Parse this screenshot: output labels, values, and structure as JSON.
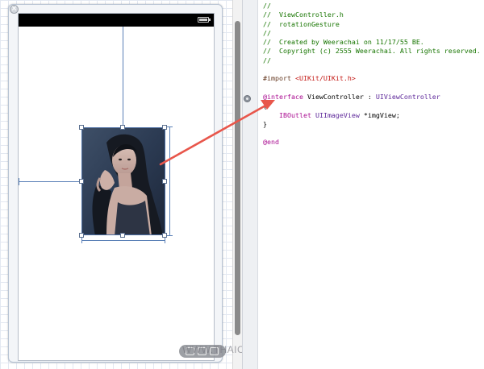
{
  "canvas": {
    "close_icon": "close-icon",
    "image_view": {
      "icon": "photo-of-woman"
    },
    "watermark": "WWW.THAICREATE.COM",
    "bottom_bar_icons": [
      "layout-icon",
      "size-icon",
      "resize-icon"
    ]
  },
  "colors": {
    "comment": "#177500",
    "keyword": "#aa0d91",
    "string": "#c41a16",
    "type": "#5c2699",
    "arrow": "#e8564b",
    "guide": "#5a80b7"
  },
  "editor": {
    "lines": [
      {
        "segments": [
          {
            "text": "//",
            "cls": "comment"
          }
        ]
      },
      {
        "segments": [
          {
            "text": "//  ViewController.h",
            "cls": "comment"
          }
        ]
      },
      {
        "segments": [
          {
            "text": "//  rotationGesture",
            "cls": "comment"
          }
        ]
      },
      {
        "segments": [
          {
            "text": "//",
            "cls": "comment"
          }
        ]
      },
      {
        "segments": [
          {
            "text": "//  Created by Weerachai on 11/17/55 BE.",
            "cls": "comment"
          }
        ]
      },
      {
        "segments": [
          {
            "text": "//  Copyright (c) 2555 Weerachai. All rights reserved.",
            "cls": "comment"
          }
        ]
      },
      {
        "segments": [
          {
            "text": "//",
            "cls": "comment"
          }
        ]
      },
      {
        "segments": [
          {
            "text": "",
            "cls": ""
          }
        ]
      },
      {
        "segments": [
          {
            "text": "#import ",
            "cls": "directive"
          },
          {
            "text": "<UIKit/UIKit.h>",
            "cls": "string"
          }
        ]
      },
      {
        "segments": [
          {
            "text": "",
            "cls": ""
          }
        ]
      },
      {
        "segments": [
          {
            "text": "@interface",
            "cls": "keyword"
          },
          {
            "text": " ViewController : ",
            "cls": ""
          },
          {
            "text": "UIViewController",
            "cls": "type"
          }
        ]
      },
      {
        "segments": [
          {
            "text": "{",
            "cls": ""
          }
        ]
      },
      {
        "segments": [
          {
            "text": "    IBOutlet",
            "cls": "keyword"
          },
          {
            "text": " ",
            "cls": ""
          },
          {
            "text": "UIImageView",
            "cls": "type"
          },
          {
            "text": " *imgView;",
            "cls": ""
          }
        ]
      },
      {
        "segments": [
          {
            "text": "}",
            "cls": ""
          }
        ]
      },
      {
        "segments": [
          {
            "text": "",
            "cls": ""
          }
        ]
      },
      {
        "segments": [
          {
            "text": "@end",
            "cls": "keyword"
          }
        ]
      }
    ]
  }
}
